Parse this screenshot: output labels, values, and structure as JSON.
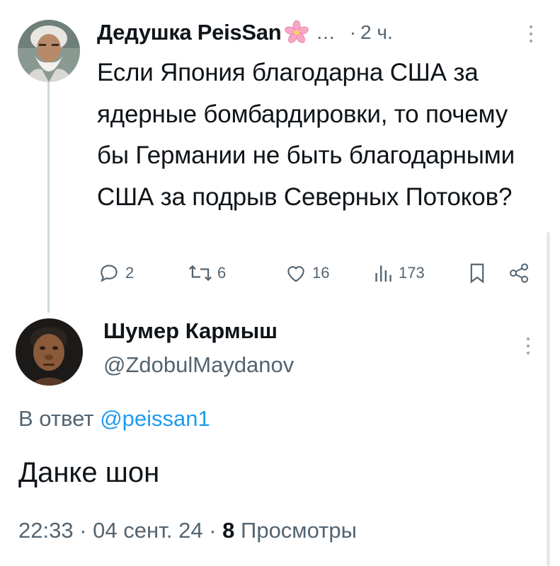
{
  "tweet": {
    "author": "Дедушка PeisSan",
    "truncation": "...",
    "separator": "·",
    "time": "2 ч.",
    "text": "Если Япония благодарна США за ядерные бомбардировки, то почему бы Германии не быть благодарными США за подрыв Северных Потоков?",
    "icons": [
      "sakura-flower-icon",
      "more-icon"
    ],
    "actions": {
      "replies": "2",
      "retweets": "6",
      "likes": "16",
      "views": "173"
    }
  },
  "reply": {
    "author": "Шумер Кармыш",
    "handle": "@ZdobulMaydanov",
    "reply_to_label": "В ответ",
    "reply_to_handle": "@peissan1",
    "text": "Данке шон",
    "time": "22:33",
    "date": "04 сент. 24",
    "separator": "·",
    "views_count": "8",
    "views_label": "Просмотры"
  },
  "colors": {
    "text": "#0f1419",
    "secondary": "#536471",
    "accent": "#1d9bf0",
    "thread_line": "#cfd9de"
  }
}
